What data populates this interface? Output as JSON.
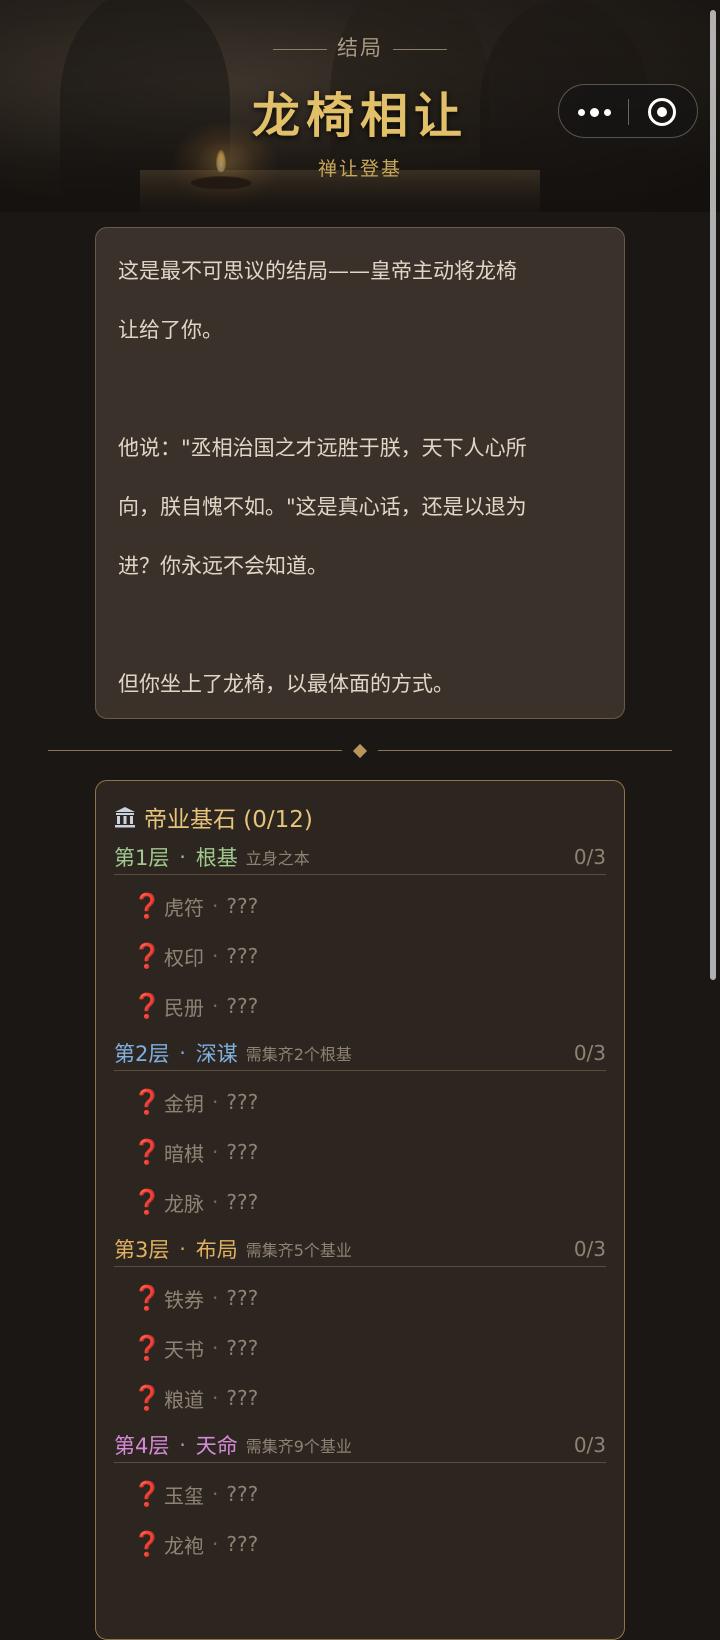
{
  "header": {
    "kicker": "结局",
    "title": "龙椅相让",
    "subtitle": "禅让登基"
  },
  "capsule": {
    "more_icon": "more-dots-icon",
    "close_icon": "close-target-icon"
  },
  "story": {
    "paragraphs": [
      "这是最不可思议的结局——皇帝主动将龙椅",
      "让给了你。",
      "",
      "他说：\"丞相治国之才远胜于朕，天下人心所",
      "向，朕自愧不如。\"这是真心话，还是以退为",
      "进？你永远不会知道。",
      "",
      "但你坐上了龙椅，以最体面的方式。"
    ]
  },
  "collection": {
    "icon": "bank-icon",
    "title": "帝业基石 (0/12)",
    "tiers": [
      {
        "level": "第1层",
        "name": "根基",
        "req": "立身之本",
        "count": "0/3",
        "color": "#9fc98f",
        "items": [
          {
            "name": "虎符",
            "desc": "???"
          },
          {
            "name": "权印",
            "desc": "???"
          },
          {
            "name": "民册",
            "desc": "???"
          }
        ]
      },
      {
        "level": "第2层",
        "name": "深谋",
        "req": "需集齐2个根基",
        "count": "0/3",
        "color": "#7fb0e0",
        "items": [
          {
            "name": "金钥",
            "desc": "???"
          },
          {
            "name": "暗棋",
            "desc": "???"
          },
          {
            "name": "龙脉",
            "desc": "???"
          }
        ]
      },
      {
        "level": "第3层",
        "name": "布局",
        "req": "需集齐5个基业",
        "count": "0/3",
        "color": "#e0b161",
        "items": [
          {
            "name": "铁券",
            "desc": "???"
          },
          {
            "name": "天书",
            "desc": "???"
          },
          {
            "name": "粮道",
            "desc": "???"
          }
        ]
      },
      {
        "level": "第4层",
        "name": "天命",
        "req": "需集齐9个基业",
        "count": "0/3",
        "color": "#d58ad8",
        "items": [
          {
            "name": "玉玺",
            "desc": "???"
          },
          {
            "name": "龙袍",
            "desc": "???"
          }
        ]
      }
    ],
    "item_mark": "❓",
    "separator": "·"
  }
}
